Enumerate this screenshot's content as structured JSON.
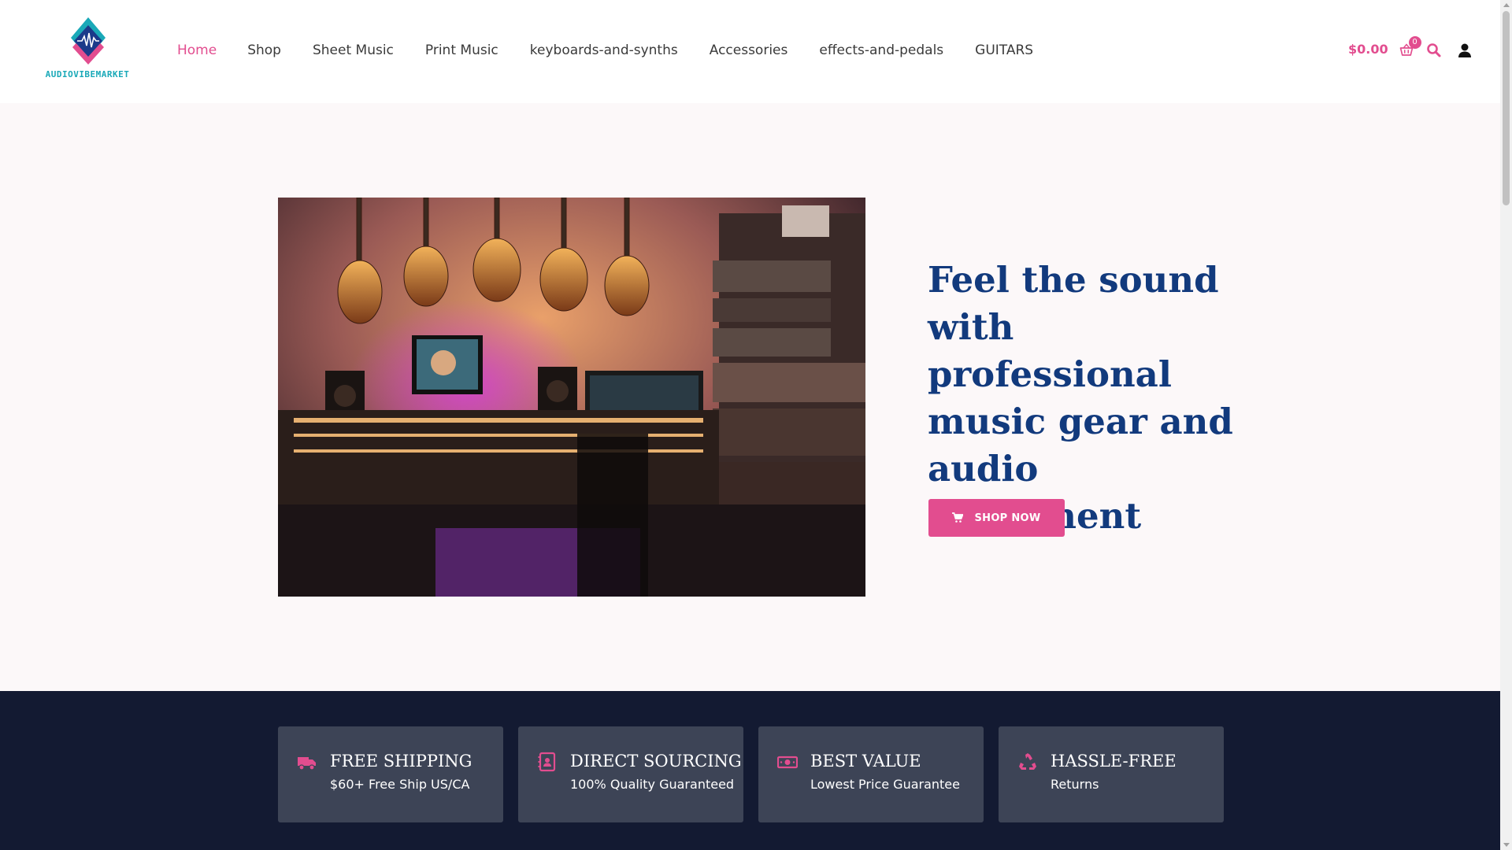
{
  "brand": {
    "name": "AUDIOVIBEMARKET",
    "colors": {
      "accent": "#e24d8f",
      "teal": "#1aa9b8",
      "heading": "#123a7d",
      "dark_band": "#131a32",
      "card": "#3d4456"
    }
  },
  "nav": {
    "items": [
      {
        "label": "Home",
        "active": true
      },
      {
        "label": "Shop",
        "active": false
      },
      {
        "label": "Sheet Music",
        "active": false
      },
      {
        "label": "Print Music",
        "active": false
      },
      {
        "label": "keyboards-and-synths",
        "active": false
      },
      {
        "label": "Accessories",
        "active": false
      },
      {
        "label": "effects-and-pedals",
        "active": false
      },
      {
        "label": "GUITARS",
        "active": false
      }
    ]
  },
  "cart": {
    "total": "$0.00",
    "count": "0",
    "icon": "cart-icon"
  },
  "header_icons": {
    "search": "search-icon",
    "account": "user-icon"
  },
  "hero": {
    "image": "recording studio with guitars on the wall and mixing console",
    "title": "Feel the sound with professional music gear and audio equipment",
    "button_label": "SHOP NOW",
    "button_icon": "cart-icon"
  },
  "features": [
    {
      "title": "FREE SHIPPING",
      "subtitle": "$60+ Free Ship US/CA",
      "icon": "truck-icon"
    },
    {
      "title": "DIRECT SOURCING",
      "subtitle": "100% Quality Guaranteed",
      "icon": "contact-book-icon"
    },
    {
      "title": "BEST VALUE",
      "subtitle": "Lowest Price Guarantee",
      "icon": "money-bill-icon"
    },
    {
      "title": "HASSLE-FREE",
      "subtitle": "Returns",
      "icon": "recycle-icon"
    }
  ]
}
